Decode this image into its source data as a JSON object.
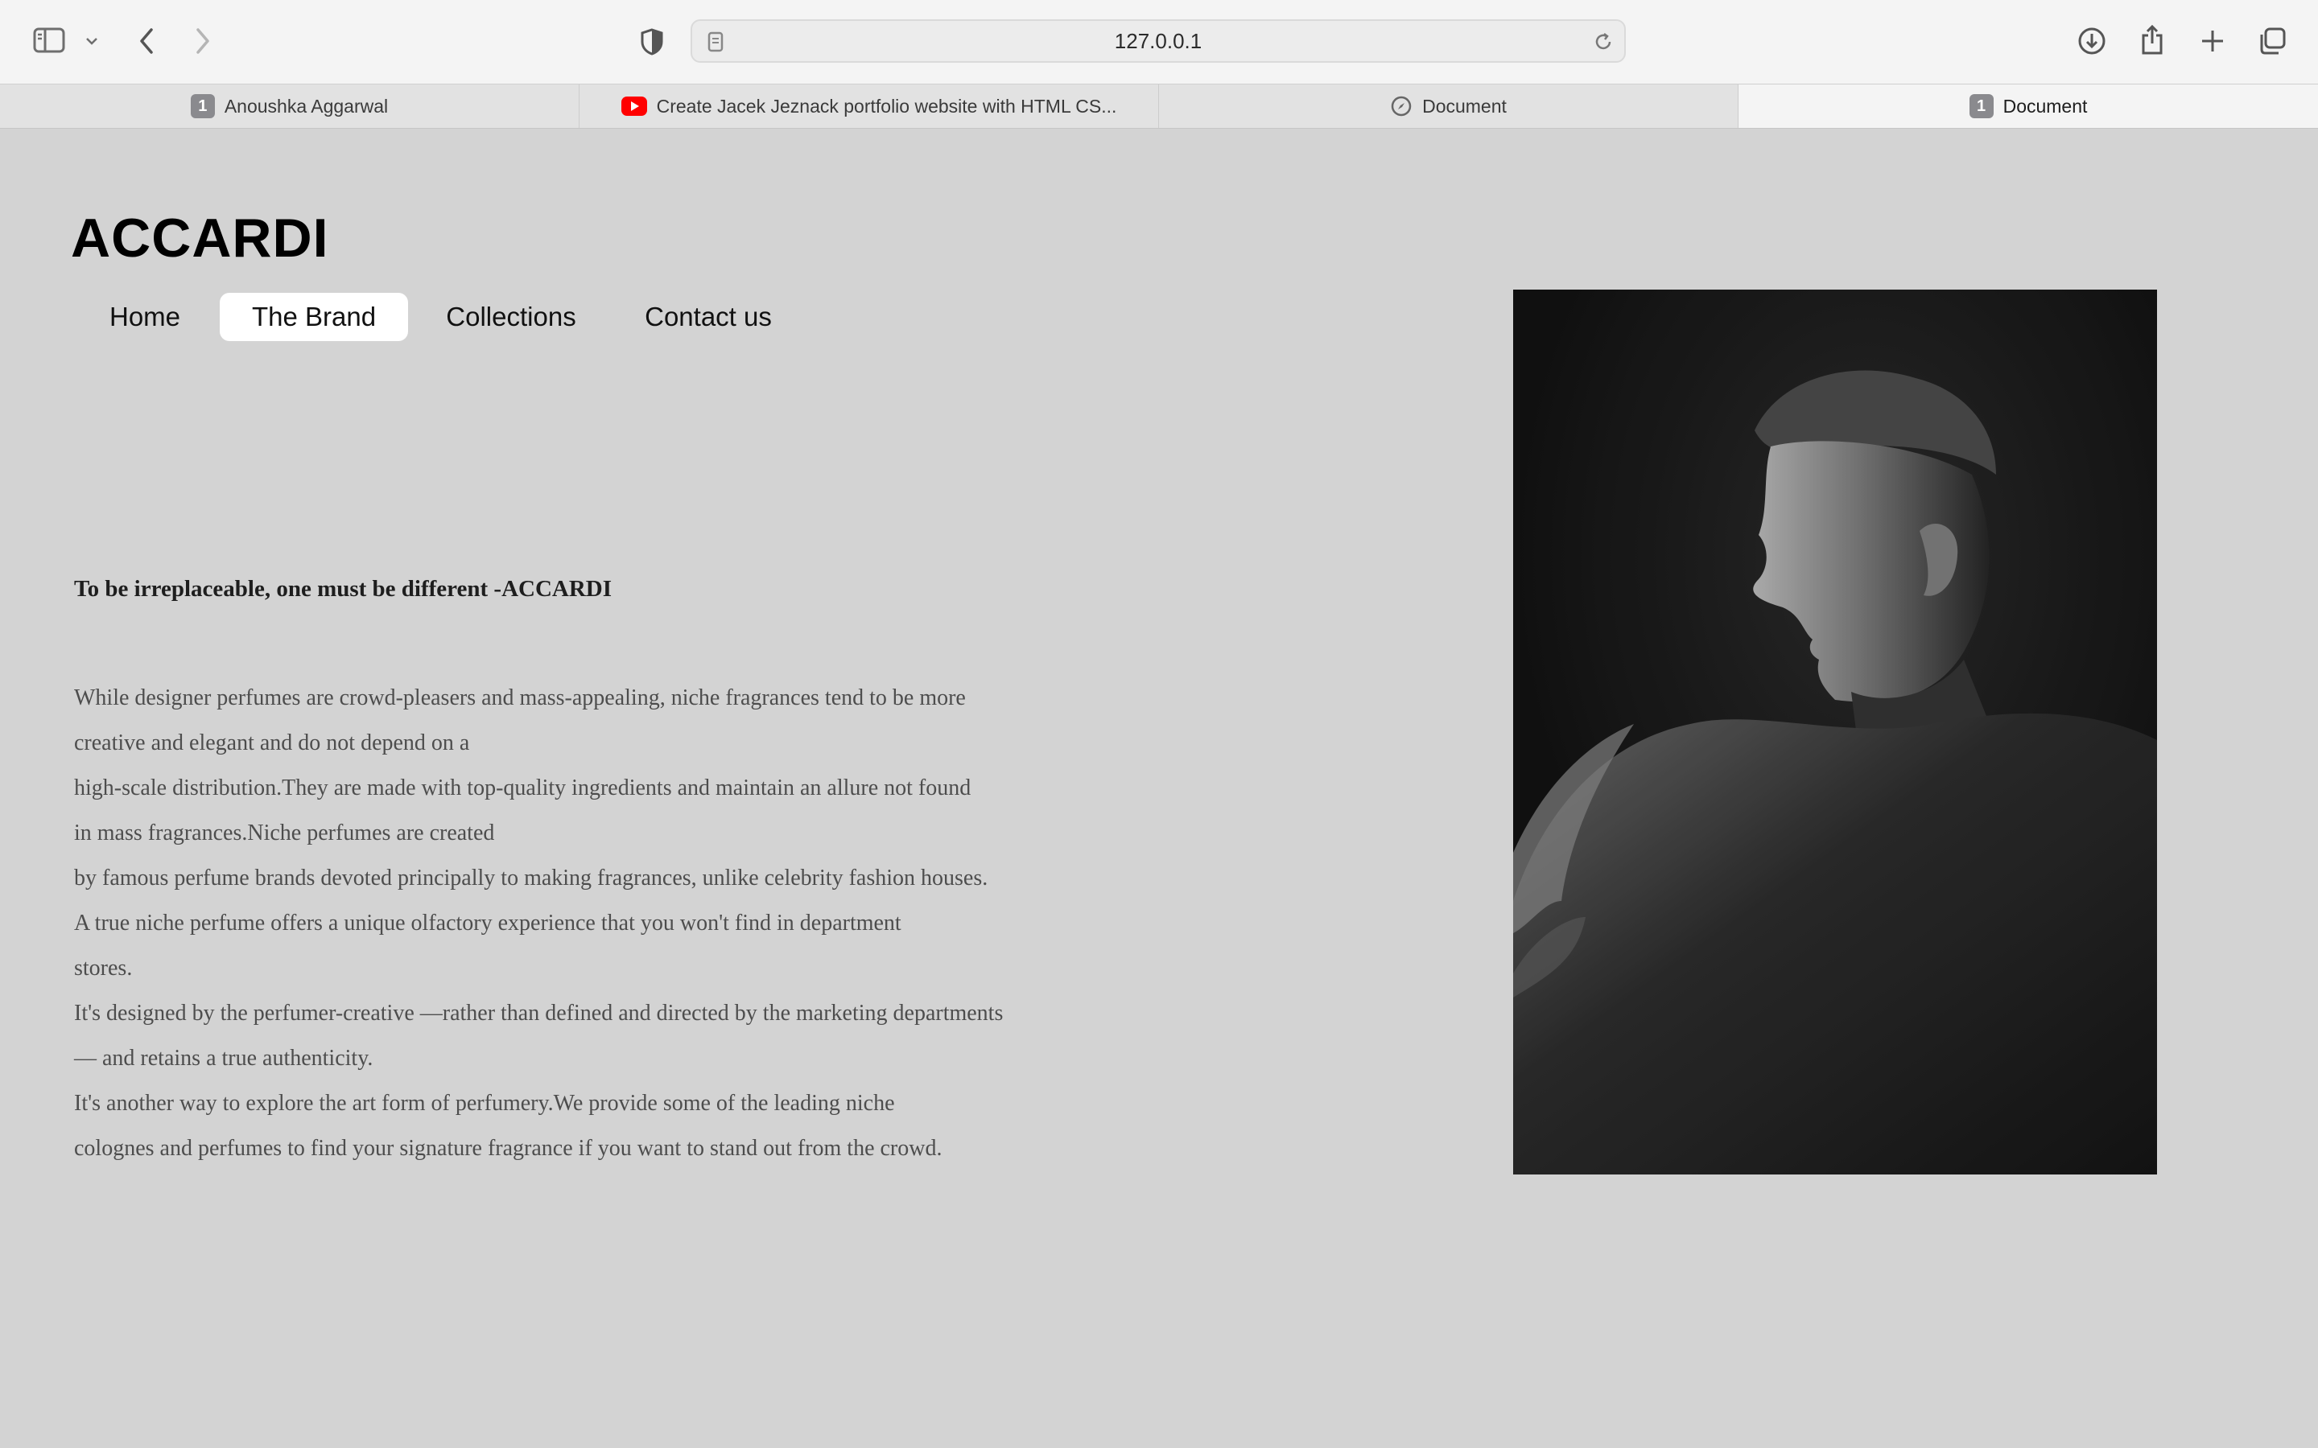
{
  "browser": {
    "url": "127.0.0.1",
    "tabs": [
      {
        "label": "Anoushka Aggarwal",
        "badge": "1",
        "icon": "number-badge-icon",
        "active": false
      },
      {
        "label": "Create Jacek Jeznack portfolio website with HTML CS...",
        "icon": "youtube-icon",
        "active": false
      },
      {
        "label": "Document",
        "icon": "compass-icon",
        "active": false
      },
      {
        "label": "Document",
        "badge": "1",
        "icon": "number-badge-icon",
        "active": true
      }
    ],
    "icons": [
      "sidebar-icon",
      "chevron-down-icon",
      "back-icon",
      "forward-icon",
      "shield-icon",
      "page-icon",
      "reload-icon",
      "download-icon",
      "share-icon",
      "new-tab-icon",
      "tab-overview-icon"
    ]
  },
  "site": {
    "logo": "ACCARDI",
    "nav": [
      {
        "label": "Home",
        "active": false
      },
      {
        "label": "The Brand",
        "active": true
      },
      {
        "label": "Collections",
        "active": false
      },
      {
        "label": "Contact us",
        "active": false
      }
    ],
    "quote": "To be irreplaceable, one must be different -ACCARDI",
    "paragraph_lines": [
      "While designer perfumes are crowd-pleasers and mass-appealing, niche fragrances tend to be more",
      "creative and elegant and do not depend on a",
      "high-scale distribution.They are made with top-quality ingredients and maintain an allure not found",
      "in mass fragrances.Niche perfumes are created",
      "by famous perfume brands devoted principally to making fragrances, unlike celebrity fashion houses.",
      "A true niche perfume offers a unique olfactory experience that you won't find in department",
      "stores.",
      "It's designed by the perfumer-creative —rather than defined and directed by the marketing departments",
      "— and retains a true authenticity.",
      "It's another way to explore the art form of perfumery.We provide some of the leading niche",
      "colognes and perfumes to find your signature fragrance if you want to stand out from the crowd."
    ],
    "image": "black-and-white portrait photo"
  },
  "colors": {
    "page_background": "#d3d3d3",
    "active_nav": "#ffffff",
    "photo_background": "#141414"
  }
}
